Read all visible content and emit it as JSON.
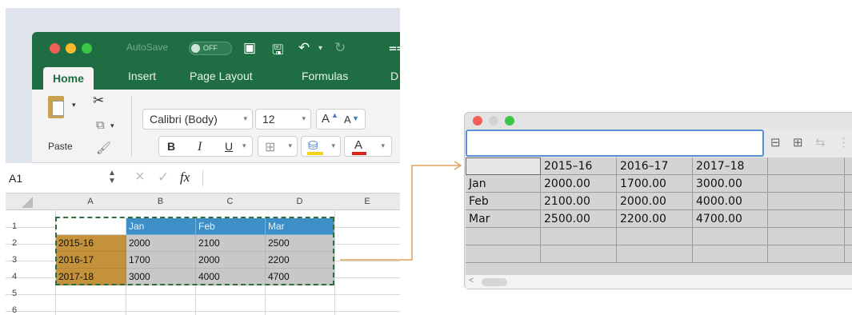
{
  "excel": {
    "title_bar": {
      "autosave_label": "AutoSave",
      "autosave_state": "OFF"
    },
    "tabs": [
      "Home",
      "Insert",
      "Page Layout",
      "Formulas",
      "D"
    ],
    "ribbon": {
      "paste_label": "Paste",
      "font_name": "Calibri (Body)",
      "font_size": "12",
      "bold": "B",
      "italic": "I",
      "underline": "U",
      "grow_font": "A",
      "shrink_font": "A",
      "font_color": "A"
    },
    "formula_bar": {
      "name_box": "A1",
      "fx": "fx"
    },
    "columns": [
      "A",
      "B",
      "C",
      "D",
      "E"
    ],
    "rows": [
      "1",
      "2",
      "3",
      "4",
      "5",
      "6"
    ],
    "header_row": [
      "",
      "Jan",
      "Feb",
      "Mar"
    ],
    "data_rows": [
      [
        "2015-16",
        "2000",
        "2100",
        "2500"
      ],
      [
        "2016-17",
        "1700",
        "2000",
        "2200"
      ],
      [
        "2017-18",
        "3000",
        "4000",
        "4700"
      ]
    ],
    "colors": {
      "ribbon_green": "#1f6e43",
      "header_blue": "#3e8fc7",
      "year_gold": "#c3923a",
      "selection_border": "#2d6d3d"
    }
  },
  "arrow_color": "#e2a25c",
  "grid_window": {
    "input_value": "",
    "header_row": [
      "",
      "2015–16",
      "2016–17",
      "2017–18"
    ],
    "data_rows": [
      [
        "Jan",
        "2000.00",
        "1700.00",
        "3000.00"
      ],
      [
        "Feb",
        "2100.00",
        "2000.00",
        "4000.00"
      ],
      [
        "Mar",
        "2500.00",
        "2200.00",
        "4700.00"
      ]
    ],
    "scroll_left_glyph": "<"
  }
}
